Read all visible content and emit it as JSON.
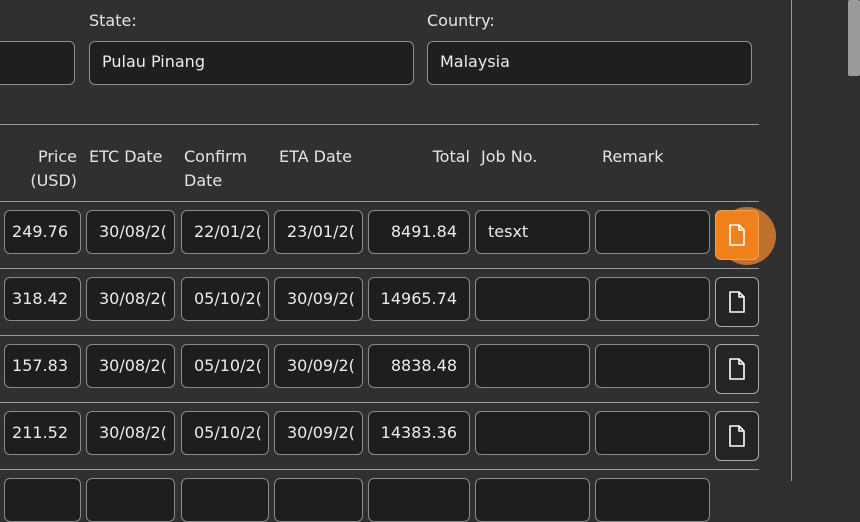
{
  "form": {
    "state_label": "State:",
    "state_value": "Pulau Pinang",
    "country_label": "Country:",
    "country_value": "Malaysia",
    "prev_field_value": ""
  },
  "table": {
    "headers": {
      "price_line1": "Price",
      "price_line2": "(USD)",
      "etc_date": "ETC Date",
      "confirm_line1": "Confirm",
      "confirm_line2": "Date",
      "eta_date": "ETA Date",
      "total": "Total",
      "job_no": "Job No.",
      "remark": "Remark"
    },
    "rows": [
      {
        "price": "249.76",
        "etc": "30/08/2(",
        "confirm": "22/01/2(",
        "eta": "23/01/2(",
        "total": "8491.84",
        "job": "tesxt",
        "remark": ""
      },
      {
        "price": "318.42",
        "etc": "30/08/2(",
        "confirm": "05/10/2(",
        "eta": "30/09/2(",
        "total": "14965.74",
        "job": "",
        "remark": ""
      },
      {
        "price": "157.83",
        "etc": "30/08/2(",
        "confirm": "05/10/2(",
        "eta": "30/09/2(",
        "total": "8838.48",
        "job": "",
        "remark": ""
      },
      {
        "price": "211.52",
        "etc": "30/08/2(",
        "confirm": "05/10/2(",
        "eta": "30/09/2(",
        "total": "14383.36",
        "job": "",
        "remark": ""
      }
    ]
  },
  "icons": {
    "doc": "document-icon"
  },
  "colors": {
    "accent": "#f0821e",
    "background": "#303030",
    "field": "#1e1e1e"
  }
}
